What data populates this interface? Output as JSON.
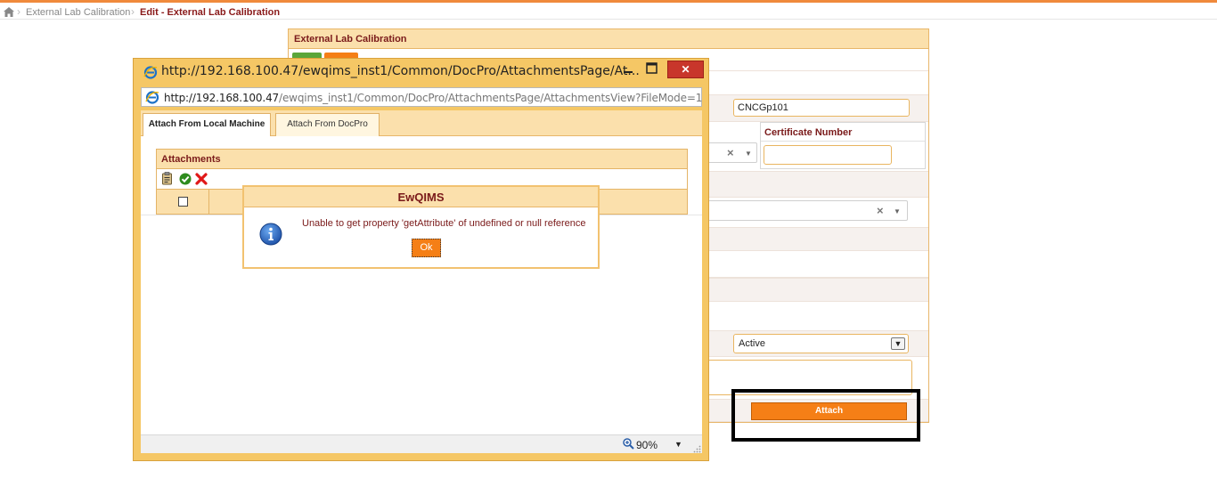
{
  "breadcrumb": {
    "items": [
      {
        "label": "External Lab Calibration"
      },
      {
        "label": "Edit - External Lab Calibration"
      }
    ]
  },
  "background_form": {
    "title": "External Lab Calibration",
    "code_value": "CNCGp101",
    "certificate_label": "Certificate Number",
    "certificate_value": "",
    "status_value": "Active",
    "attach_label": "Attach"
  },
  "popup": {
    "title": "http://192.168.100.47/ewqims_inst1/Common/DocPro/AttachmentsPage/At...",
    "address_host": "http://192.168.100.47",
    "address_path": "/ewqims_inst1/Common/DocPro/AttachmentsPage/AttachmentsView?FileMode=1",
    "close_label": "✕",
    "tabs": [
      {
        "label": "Attach From Local Machine"
      },
      {
        "label": "Attach From DocPro"
      }
    ],
    "attachments_title": "Attachments",
    "zoom_label": "90%"
  },
  "message_dialog": {
    "title": "EwQIMS",
    "message": "Unable to get property 'getAttribute' of undefined or null reference",
    "ok_label": "Ok"
  },
  "colors": {
    "accent_orange": "#f57f16",
    "header_bg": "#fbe0ac",
    "title_red": "#7a1a1a",
    "popup_frame": "#f5c765"
  }
}
